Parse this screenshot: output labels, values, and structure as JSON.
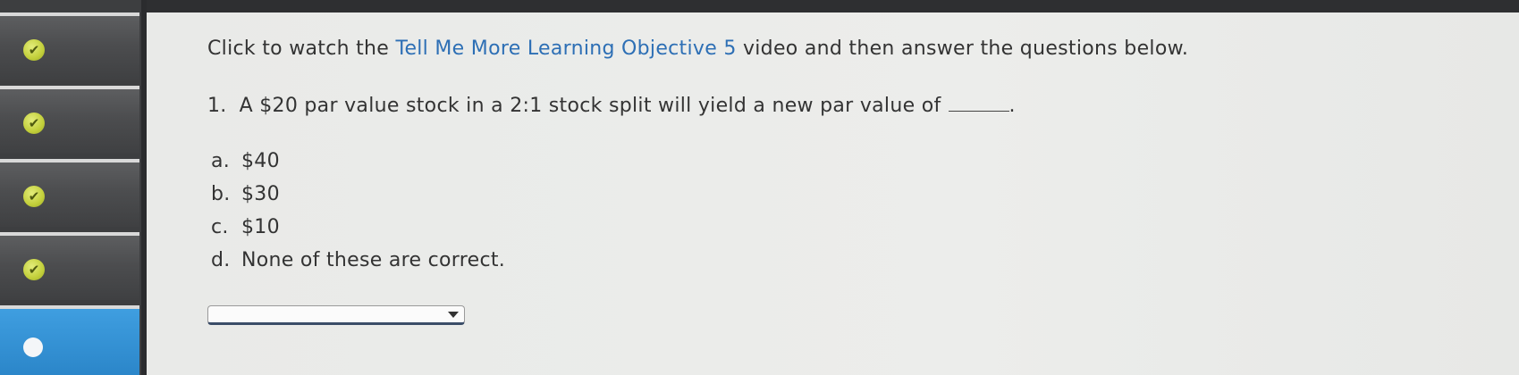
{
  "sidebar": {
    "items": [
      {
        "status": "completed",
        "icon": "checkmark-icon"
      },
      {
        "status": "completed",
        "icon": "checkmark-icon"
      },
      {
        "status": "completed",
        "icon": "checkmark-icon"
      },
      {
        "status": "completed",
        "icon": "checkmark-icon"
      },
      {
        "status": "current",
        "icon": "dot-icon"
      }
    ],
    "check_glyph": "✔",
    "active_color": "#2b86c9",
    "check_color": "#c2cf3a"
  },
  "instruction": {
    "prefix": "Click to watch the ",
    "link": "Tell Me More Learning Objective 5",
    "suffix": " video and then answer the questions below."
  },
  "question": {
    "number": "1.",
    "text": "A $20 par value stock in a 2:1 stock split will yield a new par value of",
    "end": "."
  },
  "options": [
    {
      "letter": "a.",
      "text": "$40"
    },
    {
      "letter": "b.",
      "text": "$30"
    },
    {
      "letter": "c.",
      "text": "$10"
    },
    {
      "letter": "d.",
      "text": "None of these are correct."
    }
  ],
  "answer_select": {
    "selected": ""
  }
}
